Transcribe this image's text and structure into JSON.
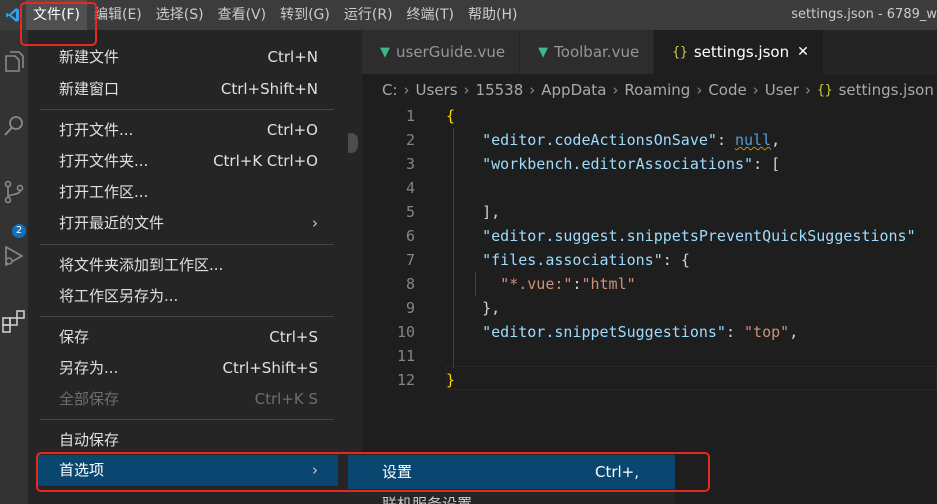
{
  "menubar": {
    "items": [
      "文件(F)",
      "编辑(E)",
      "选择(S)",
      "查看(V)",
      "转到(G)",
      "运行(R)",
      "终端(T)",
      "帮助(H)"
    ]
  },
  "window_title": "settings.json - 6789_w",
  "activity": {
    "scm_badge": "2"
  },
  "tabs": [
    {
      "label": "userGuide.vue",
      "icon": "vue-icon"
    },
    {
      "label": "Toolbar.vue",
      "icon": "vue-icon"
    },
    {
      "label": "settings.json",
      "icon": "json-icon",
      "icon_text": "{}",
      "close": "✕"
    }
  ],
  "breadcrumb": [
    "C:",
    "Users",
    "15538",
    "AppData",
    "Roaming",
    "Code",
    "User",
    "settings.json"
  ],
  "breadcrumb_icon": "{}",
  "code_lines": [
    {
      "n": "1"
    },
    {
      "n": "2"
    },
    {
      "n": "3"
    },
    {
      "n": "4"
    },
    {
      "n": "5"
    },
    {
      "n": "6"
    },
    {
      "n": "7"
    },
    {
      "n": "8"
    },
    {
      "n": "9"
    },
    {
      "n": "10"
    },
    {
      "n": "11"
    },
    {
      "n": "12"
    }
  ],
  "code": {
    "l1": "{",
    "l2_key": "\"editor.codeActionsOnSave\"",
    "l2_val": "null",
    "l3_key": "\"workbench.editorAssociations\"",
    "l3_open": "[",
    "l5": "],",
    "l6_key": "\"editor.suggest.snippetsPreventQuickSuggestions\"",
    "l7_key": "\"files.associations\"",
    "l7_open": "{",
    "l8_key": "\"*.vue:\"",
    "l8_val": "\"html\"",
    "l9": "},",
    "l10_key": "\"editor.snippetSuggestions\"",
    "l10_val": "\"top\"",
    "l12": "}"
  },
  "file_menu": {
    "new_file": "新建文件",
    "new_file_kb": "Ctrl+N",
    "new_window": "新建窗口",
    "new_window_kb": "Ctrl+Shift+N",
    "open_file": "打开文件...",
    "open_file_kb": "Ctrl+O",
    "open_folder": "打开文件夹...",
    "open_folder_kb": "Ctrl+K Ctrl+O",
    "open_workspace": "打开工作区...",
    "open_recent": "打开最近的文件",
    "add_folder": "将文件夹添加到工作区...",
    "save_workspace_as": "将工作区另存为...",
    "save": "保存",
    "save_kb": "Ctrl+S",
    "save_as": "另存为...",
    "save_as_kb": "Ctrl+Shift+S",
    "save_all": "全部保存",
    "save_all_kb": "Ctrl+K S",
    "auto_save": "自动保存",
    "preferences": "首选项"
  },
  "submenu": {
    "settings": "设置",
    "settings_kb": "Ctrl+,",
    "online_services": "联机服务设置"
  },
  "colors": {
    "accent_selected": "#094771",
    "annotation": "#e8271f",
    "vue": "#41b883",
    "json": "#cbcb41"
  }
}
